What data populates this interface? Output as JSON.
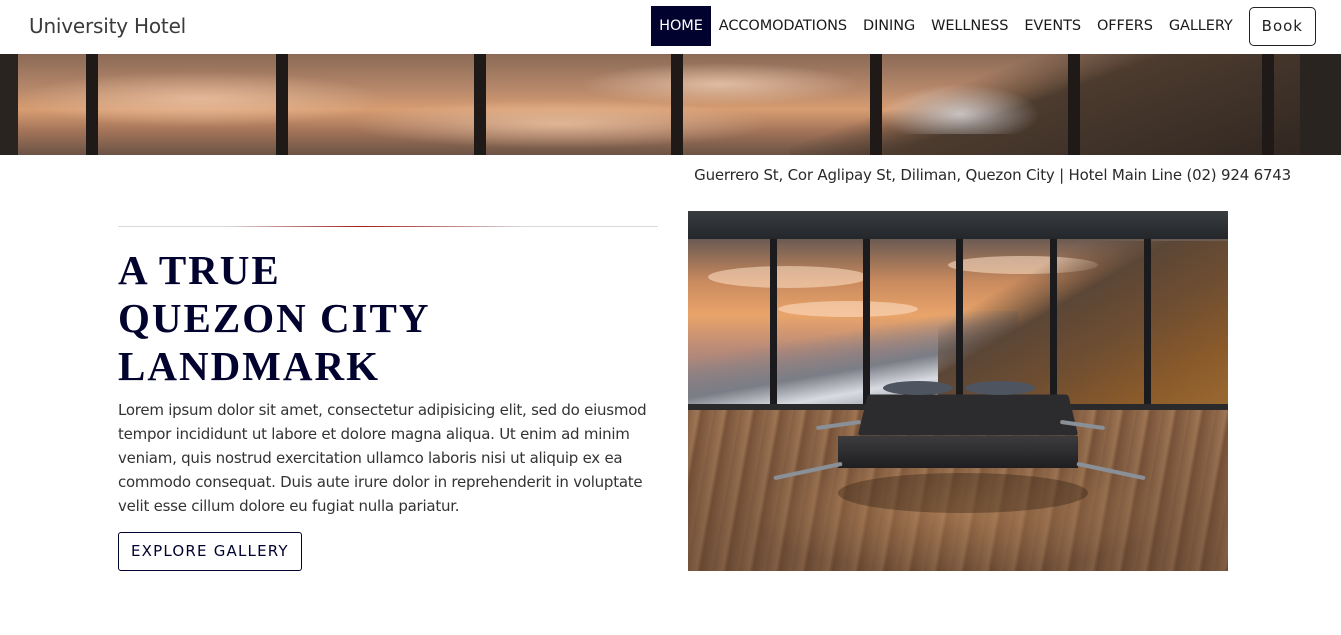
{
  "brand": {
    "name": "University Hotel"
  },
  "nav": {
    "items": [
      {
        "label": "HOME",
        "active": true
      },
      {
        "label": "ACCOMODATIONS",
        "active": false
      },
      {
        "label": "DINING",
        "active": false
      },
      {
        "label": "WELLNESS",
        "active": false
      },
      {
        "label": "EVENTS",
        "active": false
      },
      {
        "label": "OFFERS",
        "active": false
      },
      {
        "label": "GALLERY",
        "active": false
      }
    ],
    "book_label": "Book"
  },
  "address_line": "Guerrero St, Cor Aglipay St, Diliman, Quezon City | Hotel Main Line (02) 924 6743",
  "hero": {
    "headline": [
      "A TRUE",
      "QUEZON CITY",
      "LANDMARK"
    ],
    "body": "Lorem ipsum dolor sit amet, consectetur adipisicing elit, sed do eiusmod tempor incididunt ut labore et dolore magna aliqua. Ut enim ad minim veniam, quis nostrud exercitation ullamco laboris nisi ut aliquip ex ea commodo consequat. Duis aute irure dolor in reprehenderit in voluptate velit esse cillum dolore eu fugiat nulla pariatur.",
    "cta_label": "EXPLORE GALLERY"
  },
  "colors": {
    "nav_active_bg": "#01022e",
    "headline": "#01022e",
    "divider_accent": "#a31b1b"
  }
}
